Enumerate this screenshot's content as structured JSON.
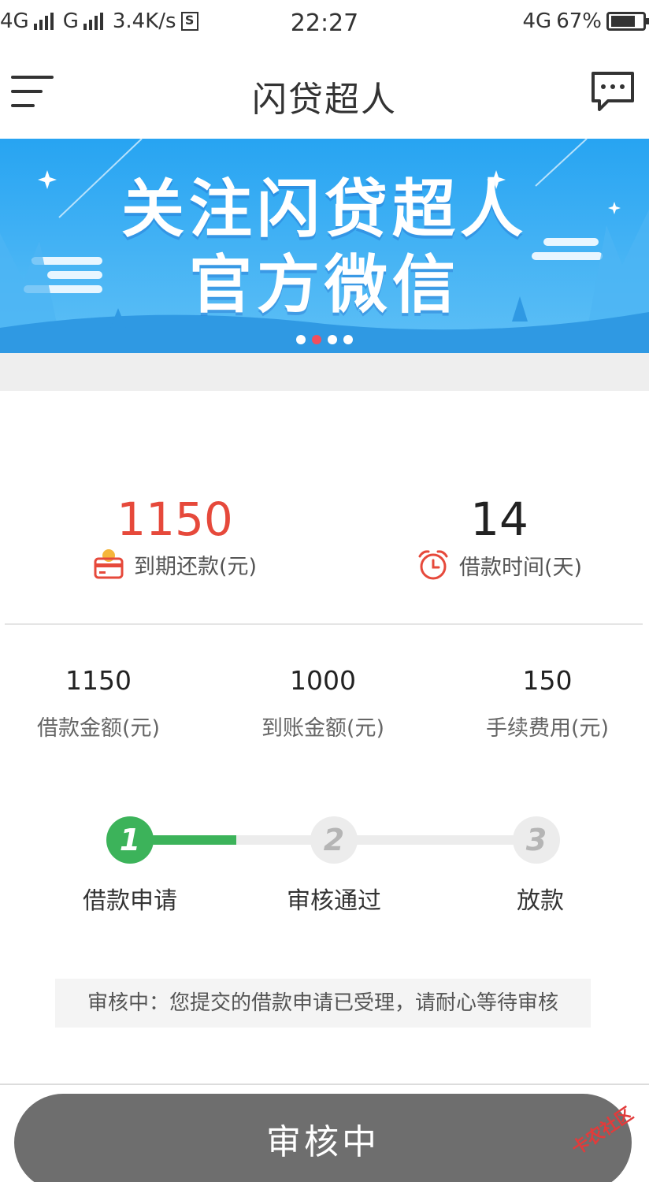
{
  "status_bar": {
    "network1": "4G",
    "network2": "G",
    "speed": "3.4K/s",
    "sim_icon": "S",
    "time": "22:27",
    "network_right": "4G",
    "battery": "67%"
  },
  "nav": {
    "title": "闪贷超人",
    "menu_icon": "menu-icon",
    "chat_icon": "chat-icon"
  },
  "banner": {
    "line1": "关注闪贷超人",
    "line2": "官方微信",
    "dots": 4,
    "active_dot": 1,
    "colors": {
      "sky_top": "#27a4f2",
      "sky_bottom": "#5fc0f6"
    }
  },
  "summary": {
    "repay_amount": "1150",
    "repay_label": "到期还款(元)",
    "days": "14",
    "days_label": "借款时间(天)"
  },
  "details": [
    {
      "value": "1150",
      "label": "借款金额(元)"
    },
    {
      "value": "1000",
      "label": "到账金额(元)"
    },
    {
      "value": "150",
      "label": "手续费用(元)"
    }
  ],
  "steps": [
    {
      "number": "1",
      "label": "借款申请",
      "state": "done"
    },
    {
      "number": "2",
      "label": "审核通过",
      "state": "pending"
    },
    {
      "number": "3",
      "label": "放款",
      "state": "pending"
    }
  ],
  "notice": "审核中：您提交的借款申请已受理，请耐心等待审核",
  "button": {
    "label": "审核中"
  },
  "watermark": "卡农社区",
  "colors": {
    "accent_red": "#e6493b",
    "step_green": "#3cb35a",
    "button_gray": "#6e6e6e"
  }
}
